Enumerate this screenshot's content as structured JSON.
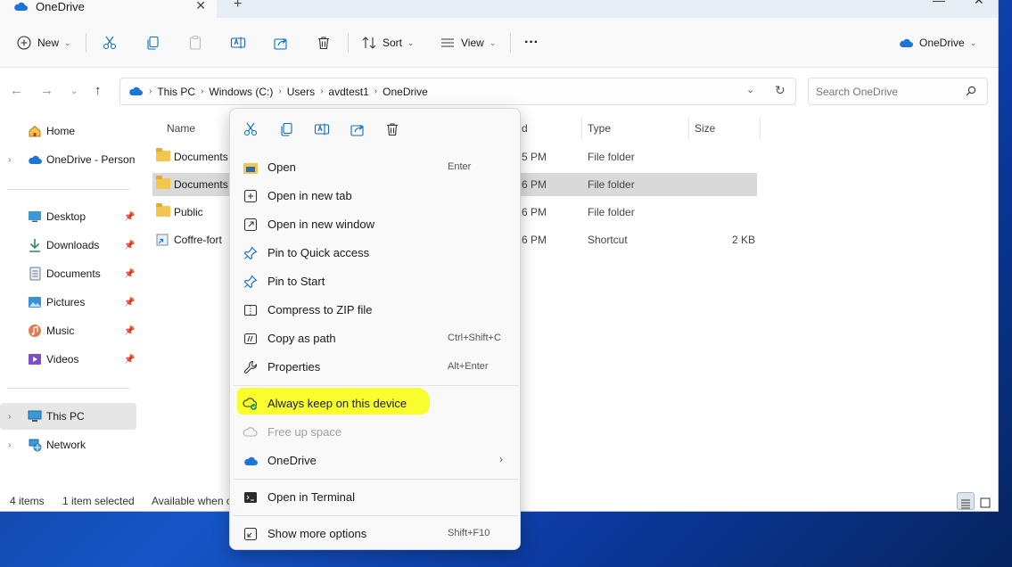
{
  "tab": {
    "title": "OneDrive",
    "close_glyph": "✕",
    "new_glyph": "+"
  },
  "toolbar": {
    "new_label": "New",
    "sort_label": "Sort",
    "view_label": "View",
    "more_glyph": "···",
    "onedrive_label": "OneDrive"
  },
  "address": {
    "crumbs": [
      "This PC",
      "Windows (C:)",
      "Users",
      "avdtest1",
      "OneDrive"
    ],
    "search_placeholder": "Search OneDrive"
  },
  "sidebar": {
    "home": "Home",
    "onedrive": "OneDrive - Persona",
    "quick": [
      {
        "label": "Desktop",
        "icon": "desktop-icon"
      },
      {
        "label": "Downloads",
        "icon": "download-icon"
      },
      {
        "label": "Documents",
        "icon": "documents-icon"
      },
      {
        "label": "Pictures",
        "icon": "pictures-icon"
      },
      {
        "label": "Music",
        "icon": "music-icon"
      },
      {
        "label": "Videos",
        "icon": "videos-icon"
      }
    ],
    "thispc": "This PC",
    "network": "Network"
  },
  "columns": {
    "name": "Name",
    "date_partial": "d",
    "type": "Type",
    "size": "Size"
  },
  "rows": [
    {
      "name": "Documents",
      "date": "5 PM",
      "type": "File folder",
      "size": ""
    },
    {
      "name": "Documents",
      "date": "6 PM",
      "type": "File folder",
      "size": ""
    },
    {
      "name": "Public",
      "date": "6 PM",
      "type": "File folder",
      "size": ""
    },
    {
      "name": "Coffre-fort",
      "date": "6 PM",
      "type": "Shortcut",
      "size": "2 KB"
    }
  ],
  "status": {
    "count": "4 items",
    "selected": "1 item selected",
    "availability": "Available when o"
  },
  "context_menu": {
    "items": [
      {
        "label": "Open",
        "shortcut": "Enter"
      },
      {
        "label": "Open in new tab",
        "shortcut": ""
      },
      {
        "label": "Open in new window",
        "shortcut": ""
      },
      {
        "label": "Pin to Quick access",
        "shortcut": ""
      },
      {
        "label": "Pin to Start",
        "shortcut": ""
      },
      {
        "label": "Compress to ZIP file",
        "shortcut": ""
      },
      {
        "label": "Copy as path",
        "shortcut": "Ctrl+Shift+C"
      },
      {
        "label": "Properties",
        "shortcut": "Alt+Enter"
      }
    ],
    "keep": "Always keep on this device",
    "free": "Free up space",
    "onedrive": "OneDrive",
    "terminal": "Open in Terminal",
    "more": {
      "label": "Show more options",
      "shortcut": "Shift+F10"
    }
  },
  "colors": {
    "accent": "#0f6cbd",
    "onedrive_blue": "#1b74d6",
    "folder": "#f3c64e",
    "highlight": "#f7ff1a",
    "keep_green": "#2e9e3e"
  }
}
